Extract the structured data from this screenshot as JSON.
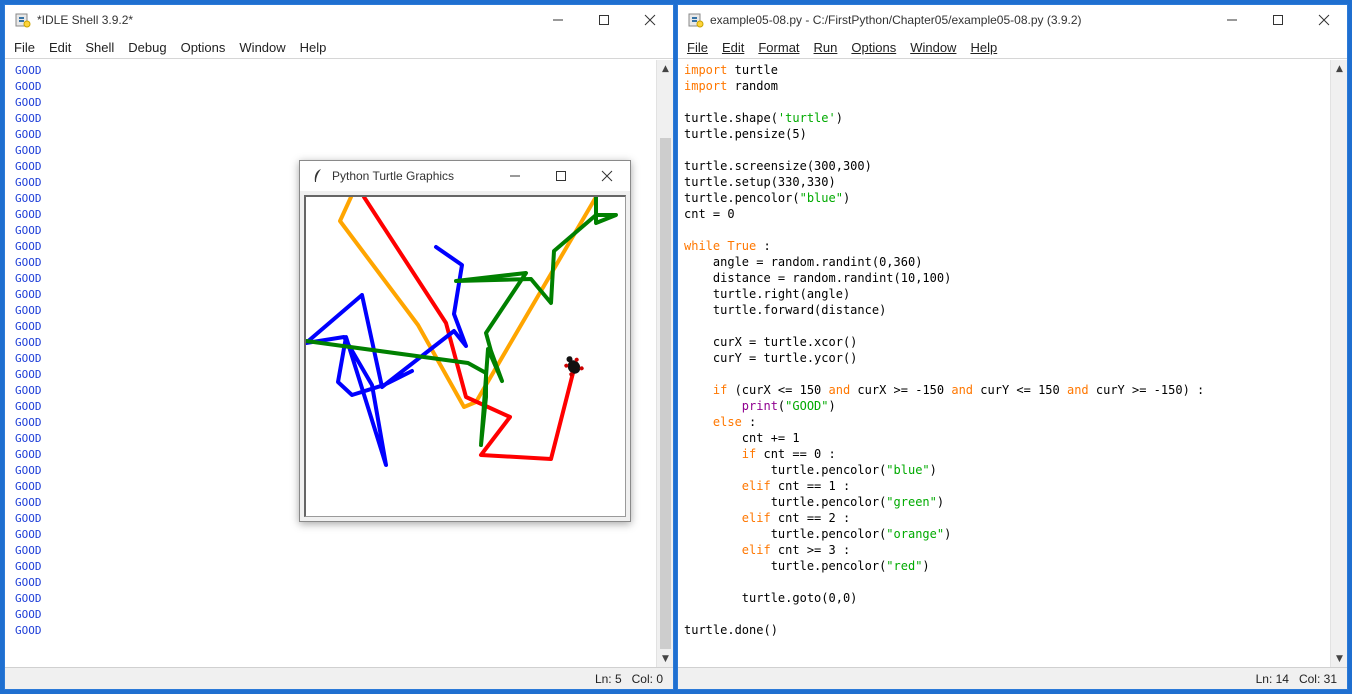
{
  "shell": {
    "title": "*IDLE Shell 3.9.2*",
    "menu": [
      "File",
      "Edit",
      "Shell",
      "Debug",
      "Options",
      "Window",
      "Help"
    ],
    "output": [
      "GOOD",
      "GOOD",
      "GOOD",
      "GOOD",
      "GOOD",
      "GOOD",
      "GOOD",
      "GOOD",
      "GOOD",
      "GOOD",
      "GOOD",
      "GOOD",
      "GOOD",
      "GOOD",
      "GOOD",
      "GOOD",
      "GOOD",
      "GOOD",
      "GOOD",
      "GOOD",
      "GOOD",
      "GOOD",
      "GOOD",
      "GOOD",
      "GOOD",
      "GOOD",
      "GOOD",
      "GOOD",
      "GOOD",
      "GOOD",
      "GOOD",
      "GOOD",
      "GOOD",
      "GOOD",
      "GOOD",
      "GOOD"
    ],
    "status_ln": "Ln: 5",
    "status_col": "Col: 0"
  },
  "editor": {
    "title": "example05-08.py - C:/FirstPython/Chapter05/example05-08.py (3.9.2)",
    "menu": [
      "File",
      "Edit",
      "Format",
      "Run",
      "Options",
      "Window",
      "Help"
    ],
    "status_ln": "Ln: 14",
    "status_col": "Col: 31",
    "code": [
      [
        [
          "kw",
          "import"
        ],
        [
          "",
          "turtle"
        ]
      ],
      [
        [
          "kw",
          "import"
        ],
        [
          "",
          "random"
        ]
      ],
      [],
      [
        [
          "",
          "turtle.shape("
        ],
        [
          "st",
          "'turtle'"
        ],
        [
          "",
          ")"
        ]
      ],
      [
        [
          "",
          "turtle.pensize(5)"
        ]
      ],
      [],
      [
        [
          "",
          "turtle.screensize(300,300)"
        ]
      ],
      [
        [
          "",
          "turtle.setup(330,330)"
        ]
      ],
      [
        [
          "",
          "turtle.pencolor("
        ],
        [
          "st",
          "\"blue\""
        ],
        [
          "",
          ")"
        ]
      ],
      [
        [
          "",
          "cnt = 0"
        ]
      ],
      [],
      [
        [
          "kw",
          "while"
        ],
        [
          "",
          ""
        ],
        [
          "kw",
          "True"
        ],
        [
          "",
          " :"
        ]
      ],
      [
        [
          "",
          "    angle = random.randint(0,360)"
        ]
      ],
      [
        [
          "",
          "    distance = random.randint(10,100)"
        ]
      ],
      [
        [
          "",
          "    turtle.right(angle)"
        ]
      ],
      [
        [
          "",
          "    turtle.forward(distance)"
        ]
      ],
      [],
      [
        [
          "",
          "    curX = turtle.xcor()"
        ]
      ],
      [
        [
          "",
          "    curY = turtle.ycor()"
        ]
      ],
      [],
      [
        [
          "",
          "    "
        ],
        [
          "kw",
          "if"
        ],
        [
          "",
          " (curX <= 150 "
        ],
        [
          "kw",
          "and"
        ],
        [
          "",
          " curX >= -150 "
        ],
        [
          "kw",
          "and"
        ],
        [
          "",
          " curY <= 150 "
        ],
        [
          "kw",
          "and"
        ],
        [
          "",
          " curY >= -150) :"
        ]
      ],
      [
        [
          "",
          "        "
        ],
        [
          "bi",
          "print"
        ],
        [
          "",
          "("
        ],
        [
          "st",
          "\"GOOD\""
        ],
        [
          "",
          ")"
        ]
      ],
      [
        [
          "",
          "    "
        ],
        [
          "kw",
          "else"
        ],
        [
          "",
          " :"
        ]
      ],
      [
        [
          "",
          "        cnt += 1"
        ]
      ],
      [
        [
          "",
          "        "
        ],
        [
          "kw",
          "if"
        ],
        [
          "",
          " cnt == 0 :"
        ]
      ],
      [
        [
          "",
          "            turtle.pencolor("
        ],
        [
          "st",
          "\"blue\""
        ],
        [
          "",
          ")"
        ]
      ],
      [
        [
          "",
          "        "
        ],
        [
          "kw",
          "elif"
        ],
        [
          "",
          " cnt == 1 :"
        ]
      ],
      [
        [
          "",
          "            turtle.pencolor("
        ],
        [
          "st",
          "\"green\""
        ],
        [
          "",
          ")"
        ]
      ],
      [
        [
          "",
          "        "
        ],
        [
          "kw",
          "elif"
        ],
        [
          "",
          " cnt == 2 :"
        ]
      ],
      [
        [
          "",
          "            turtle.pencolor("
        ],
        [
          "st",
          "\"orange\""
        ],
        [
          "",
          ")"
        ]
      ],
      [
        [
          "",
          "        "
        ],
        [
          "kw",
          "elif"
        ],
        [
          "",
          " cnt >= 3 :"
        ]
      ],
      [
        [
          "",
          "            turtle.pencolor("
        ],
        [
          "st",
          "\"red\""
        ],
        [
          "",
          ")"
        ]
      ],
      [],
      [
        [
          "",
          "        turtle.goto(0,0)"
        ]
      ],
      [],
      [
        [
          "",
          "turtle.done()"
        ]
      ]
    ]
  },
  "turtle_window": {
    "title": "Python Turtle Graphics",
    "colors": {
      "blue": "#0000ff",
      "green": "#008000",
      "orange": "#ffa500",
      "red": "#ff0000"
    }
  },
  "window_controls": {
    "minimize": "minimize-icon",
    "maximize": "maximize-icon",
    "close": "close-icon"
  }
}
